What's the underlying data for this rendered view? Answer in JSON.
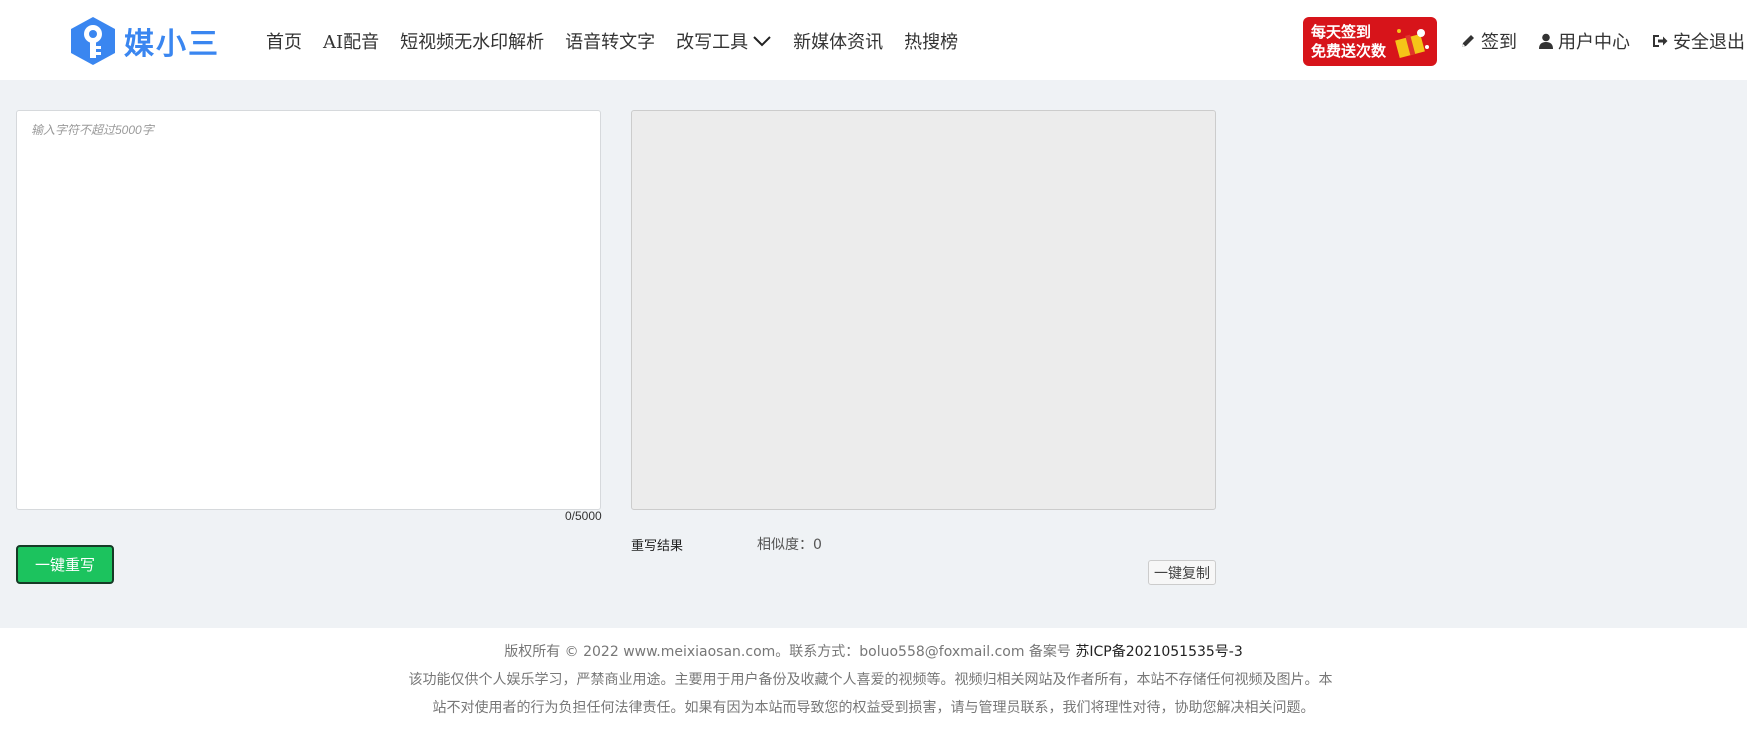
{
  "brand": {
    "name": "媒小三",
    "color": "#3a86f0"
  },
  "nav": {
    "items": [
      {
        "label": "首页"
      },
      {
        "label": "AI配音"
      },
      {
        "label": "短视频无水印解析"
      },
      {
        "label": "语音转文字"
      },
      {
        "label": "改写工具",
        "has_dropdown": true
      },
      {
        "label": "新媒体资讯"
      },
      {
        "label": "热搜榜"
      }
    ]
  },
  "promo": {
    "line1": "每天签到",
    "line2": "免费送次数",
    "color": "#d7141a"
  },
  "user_links": {
    "signin": {
      "label": "签到",
      "icon": "pencil-icon"
    },
    "user_center": {
      "label": "用户中心",
      "icon": "user-icon"
    },
    "logout": {
      "label": "安全退出",
      "icon": "sign-out-icon"
    }
  },
  "editor": {
    "input_placeholder": "输入字符不超过5000字",
    "input_value": "",
    "counter": "0/5000",
    "rewrite_button": "一键重写",
    "rewrite_button_color": "#1cc35e"
  },
  "result": {
    "label": "重写结果",
    "similarity": "相似度：0",
    "copy_button": "一键复制"
  },
  "footer": {
    "copyright": "版权所有 © 2022 www.meixiaosan.com。联系方式：boluo558@foxmail.com 备案号",
    "icp": "苏ICP备2021051535号-3",
    "disclaimer1": "该功能仅供个人娱乐学习，严禁商业用途。主要用于用户备份及收藏个人喜爱的视频等。视频归相关网站及作者所有，本站不存储任何视频及图片。本",
    "disclaimer2": "站不对使用者的行为负担任何法律责任。如果有因为本站而导致您的权益受到损害，请与管理员联系，我们将理性对待，协助您解决相关问题。"
  }
}
